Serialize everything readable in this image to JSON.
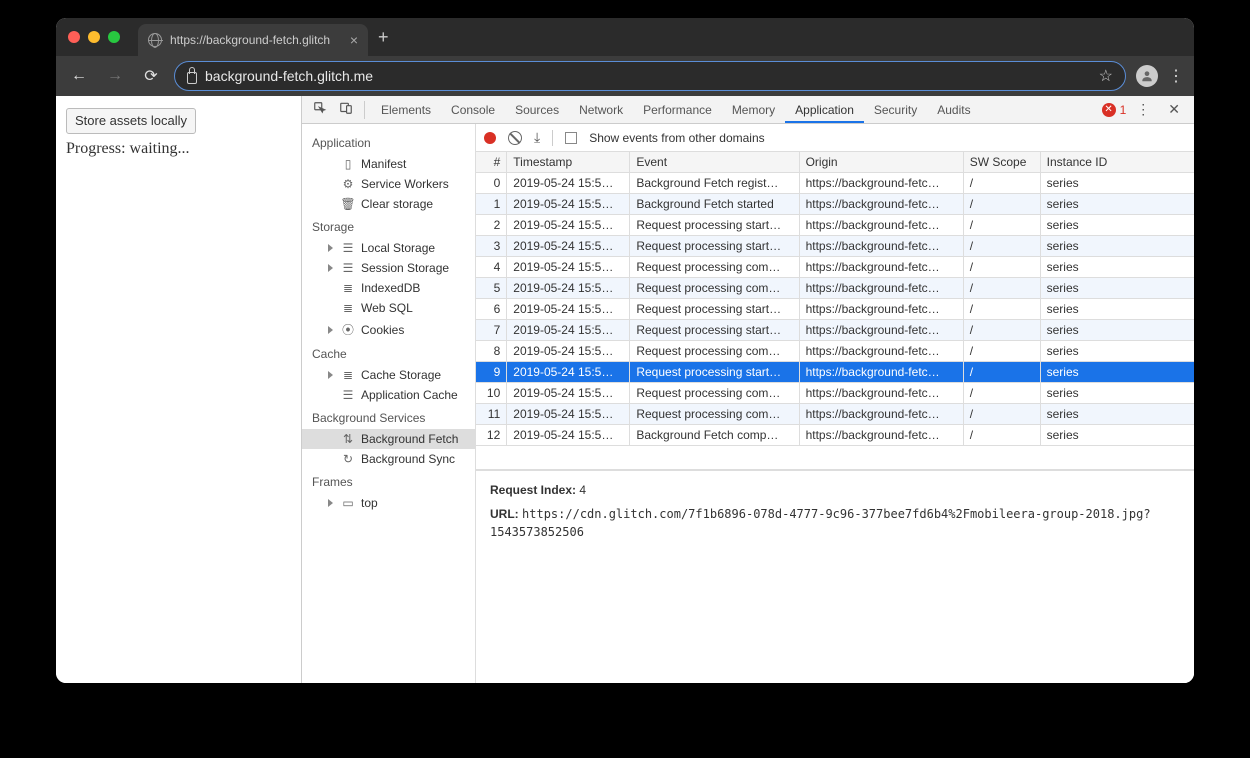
{
  "tab": {
    "title": "https://background-fetch.glitch"
  },
  "url": {
    "display": "background-fetch.glitch.me"
  },
  "page": {
    "store_button": "Store assets locally",
    "progress_label": "Progress: waiting..."
  },
  "devtools": {
    "tabs": [
      "Elements",
      "Console",
      "Sources",
      "Network",
      "Performance",
      "Memory",
      "Application",
      "Security",
      "Audits"
    ],
    "active_tab": "Application",
    "error_count": "1"
  },
  "sidebar": {
    "groups": [
      {
        "title": "Application",
        "items": [
          {
            "label": "Manifest",
            "icon": "doc"
          },
          {
            "label": "Service Workers",
            "icon": "gear"
          },
          {
            "label": "Clear storage",
            "icon": "trash"
          }
        ]
      },
      {
        "title": "Storage",
        "items": [
          {
            "label": "Local Storage",
            "icon": "db",
            "expandable": true
          },
          {
            "label": "Session Storage",
            "icon": "db",
            "expandable": true
          },
          {
            "label": "IndexedDB",
            "icon": "disks"
          },
          {
            "label": "Web SQL",
            "icon": "disks"
          },
          {
            "label": "Cookies",
            "icon": "cookie",
            "expandable": true
          }
        ]
      },
      {
        "title": "Cache",
        "items": [
          {
            "label": "Cache Storage",
            "icon": "disks",
            "expandable": true
          },
          {
            "label": "Application Cache",
            "icon": "db"
          }
        ]
      },
      {
        "title": "Background Services",
        "items": [
          {
            "label": "Background Fetch",
            "icon": "updown",
            "selected": true
          },
          {
            "label": "Background Sync",
            "icon": "sync"
          }
        ]
      },
      {
        "title": "Frames",
        "items": [
          {
            "label": "top",
            "icon": "frame",
            "expandable": true
          }
        ]
      }
    ]
  },
  "toolbar": {
    "checkbox_label": "Show events from other domains"
  },
  "table": {
    "columns": [
      "#",
      "Timestamp",
      "Event",
      "Origin",
      "SW Scope",
      "Instance ID"
    ],
    "rows": [
      {
        "n": "0",
        "ts": "2019-05-24 15:5…",
        "ev": "Background Fetch regist…",
        "or": "https://background-fetc…",
        "sw": "/",
        "id": "series"
      },
      {
        "n": "1",
        "ts": "2019-05-24 15:5…",
        "ev": "Background Fetch started",
        "or": "https://background-fetc…",
        "sw": "/",
        "id": "series"
      },
      {
        "n": "2",
        "ts": "2019-05-24 15:5…",
        "ev": "Request processing start…",
        "or": "https://background-fetc…",
        "sw": "/",
        "id": "series"
      },
      {
        "n": "3",
        "ts": "2019-05-24 15:5…",
        "ev": "Request processing start…",
        "or": "https://background-fetc…",
        "sw": "/",
        "id": "series"
      },
      {
        "n": "4",
        "ts": "2019-05-24 15:5…",
        "ev": "Request processing com…",
        "or": "https://background-fetc…",
        "sw": "/",
        "id": "series"
      },
      {
        "n": "5",
        "ts": "2019-05-24 15:5…",
        "ev": "Request processing com…",
        "or": "https://background-fetc…",
        "sw": "/",
        "id": "series"
      },
      {
        "n": "6",
        "ts": "2019-05-24 15:5…",
        "ev": "Request processing start…",
        "or": "https://background-fetc…",
        "sw": "/",
        "id": "series"
      },
      {
        "n": "7",
        "ts": "2019-05-24 15:5…",
        "ev": "Request processing start…",
        "or": "https://background-fetc…",
        "sw": "/",
        "id": "series"
      },
      {
        "n": "8",
        "ts": "2019-05-24 15:5…",
        "ev": "Request processing com…",
        "or": "https://background-fetc…",
        "sw": "/",
        "id": "series"
      },
      {
        "n": "9",
        "ts": "2019-05-24 15:5…",
        "ev": "Request processing start…",
        "or": "https://background-fetc…",
        "sw": "/",
        "id": "series",
        "selected": true
      },
      {
        "n": "10",
        "ts": "2019-05-24 15:5…",
        "ev": "Request processing com…",
        "or": "https://background-fetc…",
        "sw": "/",
        "id": "series"
      },
      {
        "n": "11",
        "ts": "2019-05-24 15:5…",
        "ev": "Request processing com…",
        "or": "https://background-fetc…",
        "sw": "/",
        "id": "series"
      },
      {
        "n": "12",
        "ts": "2019-05-24 15:5…",
        "ev": "Background Fetch comp…",
        "or": "https://background-fetc…",
        "sw": "/",
        "id": "series"
      }
    ]
  },
  "details": {
    "request_index_label": "Request Index:",
    "request_index_value": "4",
    "url_label": "URL:",
    "url_value": "https://cdn.glitch.com/7f1b6896-078d-4777-9c96-377bee7fd6b4%2Fmobileera-group-2018.jpg?1543573852506"
  }
}
